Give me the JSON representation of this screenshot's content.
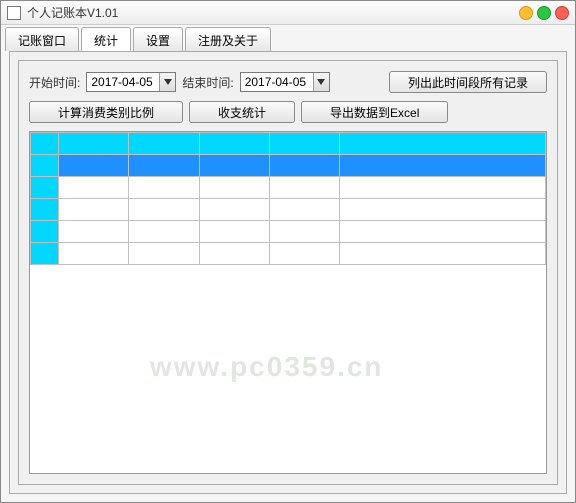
{
  "app": {
    "title": "个人记账本V1.01"
  },
  "tabs": {
    "t0": "记账窗口",
    "t1": "统计",
    "t2": "设置",
    "t3": "注册及关于"
  },
  "watermark": {
    "text1": "www.pc0359.cn",
    "text2": "www.pc0359.cn"
  },
  "filters": {
    "start_label": "开始时间:",
    "start_value": "2017-04-05",
    "end_label": "结束时间:",
    "end_value": "2017-04-05",
    "list_button": "列出此时间段所有记录"
  },
  "actions": {
    "calc_ratio": "计算消费类别比例",
    "income_expense_stat": "收支统计",
    "export_excel": "导出数据到Excel"
  },
  "grid": {
    "columns": [
      "",
      "",
      "",
      "",
      "",
      ""
    ],
    "rows": [
      {
        "selected": false
      },
      {
        "selected": true
      },
      {
        "selected": false
      },
      {
        "selected": false
      },
      {
        "selected": false
      }
    ]
  }
}
